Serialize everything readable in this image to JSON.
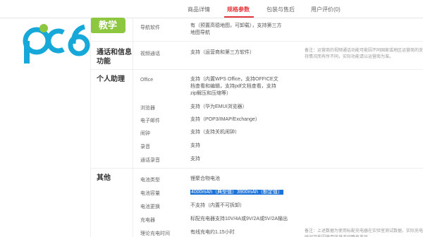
{
  "tabs": [
    "商品详情",
    "规格参数",
    "包装与售后",
    "用户评价(0)"
  ],
  "logo": {
    "text": "pc6",
    "badge": "教学"
  },
  "rows": [
    {
      "key": "导航软件",
      "value": "有（预置高德地图，可卸载），支持第三方地图导航"
    },
    {
      "key": "视频通话",
      "value": "支持（运营商和第三方软件）",
      "note": "备注：运营商的视频通话功能可能因不同国家或地区运营商的支持情况而有所不同，实际功能请以运营商为准。"
    },
    {
      "key": "Office",
      "value": "支持（内置WPS Office，支持OFFICE文档查看和编辑，支持pdf文档查看，支持zip解压和压缩等）"
    },
    {
      "key": "浏览器",
      "value": "支持（华为EMUI浏览器）"
    },
    {
      "key": "电子邮件",
      "value": "支持（POP3/IMAP/Exchange）"
    },
    {
      "key": "闹钟",
      "value": "支持（支持关机闹钟）"
    },
    {
      "key": "录音",
      "value": "支持"
    },
    {
      "key": "通话录音",
      "value": "支持"
    },
    {
      "key": "电池类型",
      "value": "锂聚合物电池"
    },
    {
      "key": "电池容量",
      "value_hl": "4000mAh（典型值）3900mAh（额定值）"
    },
    {
      "key": "电池更换",
      "value": "不支持（内置不可拆卸）"
    },
    {
      "key": "充电器",
      "value": "标配充电器支持10V/4A或9V/2A或5V/2A输出"
    },
    {
      "key": "理论充电时间",
      "value": "有线充电约1.15小时",
      "note": "备注：上述数据为使用标配充电器在实验室测试数据，实际充电时间可能因使用环境不同略有差异。"
    }
  ],
  "sections": {
    "comm": "通话和信息功能",
    "assistant": "个人助理",
    "other": "其他"
  }
}
